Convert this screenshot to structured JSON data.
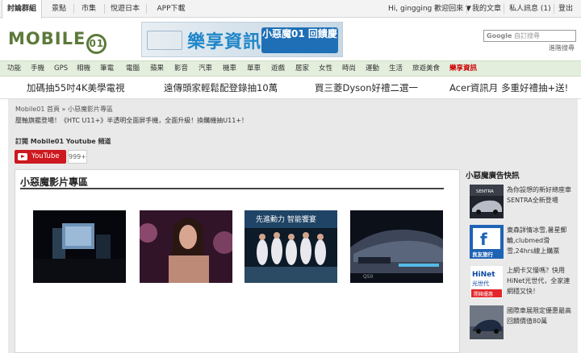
{
  "topbar": {
    "tabs": [
      "討論群組",
      "景點",
      "市集",
      "悅遊日本",
      "APP下載"
    ],
    "greeting": "Hi, gingging 歡迎回來 ▼",
    "my_articles": "我的文章",
    "messages": "私人訊息 (1)",
    "logout": "登出"
  },
  "header": {
    "logo_text": "MOBILE",
    "logo_mark": "01",
    "banner_title": "樂享資訊",
    "banner_sub": "小惡魔01 回饋慶",
    "search_brand": "Google",
    "search_placeholder": "自訂搜尋",
    "advanced_search": "進階搜尋"
  },
  "categories": [
    "功能",
    "手機",
    "GPS",
    "相機",
    "筆電",
    "電腦",
    "蘋果",
    "影音",
    "汽車",
    "機車",
    "單車",
    "遊戲",
    "居家",
    "女性",
    "時尚",
    "運動",
    "生活",
    "旅遊美食",
    "樂享資訊"
  ],
  "promos": [
    "加碼抽55吋4K美學電視",
    "遠傳頭家輕鬆配登錄抽10萬",
    "買三菱Dyson好禮二選一",
    "Acer資訊月 多重好禮抽+送!"
  ],
  "main": {
    "breadcrumb": "Mobile01 首頁 » 小惡魔影片專區",
    "description": "壓軸旗艦登場！《HTC U11+》半透明全面屏手機，全面升級！換購機抽U11+！",
    "subscribe_label": "訂閱 Mobile01 Youtube 頻道",
    "youtube_label": "YouTube",
    "subscriber_count": "999+",
    "section_title": "小惡魔影片專區"
  },
  "sidebar": {
    "title": "小惡魔廣告快訊",
    "ads": [
      {
        "text": "為你設想的新好總座車SENTRA全新登場"
      },
      {
        "text": "東森詳情冰雪,暑星郵輪,clubmed滑雪,24hrs線上購票"
      },
      {
        "text": "上網卡又慢嗎？快用HiNet光世代，全家連網穩又快！"
      },
      {
        "text": "國際車展限定優惠最高回饋價值80萬"
      }
    ]
  },
  "colors": {
    "accent_green": "#5c7a3a",
    "nav_bg": "#e4eedd",
    "highlight_red": "#cc0000",
    "youtube_red": "#cc181e"
  }
}
